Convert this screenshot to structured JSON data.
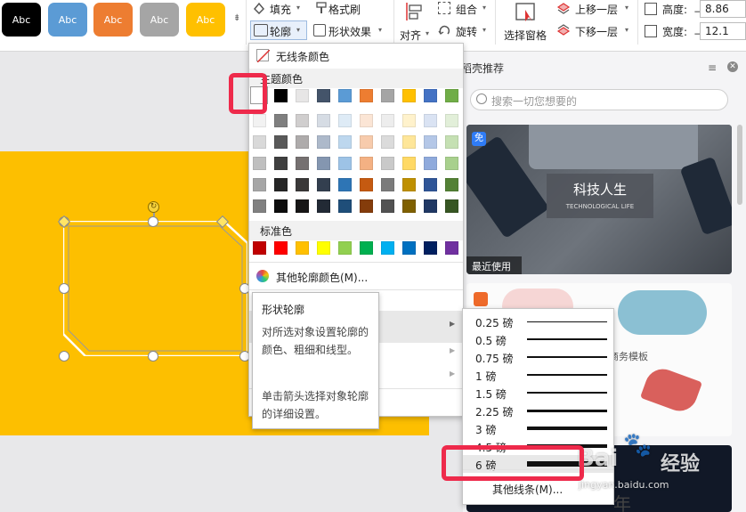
{
  "ribbon": {
    "styles": [
      "Abc",
      "Abc",
      "Abc",
      "Abc",
      "Abc"
    ],
    "fill_label": "填充",
    "format_brush_label": "格式刷",
    "outline_label": "轮廓",
    "shape_effect_label": "形状效果",
    "align_label": "对齐",
    "group_label": "组合",
    "rotate_label": "旋转",
    "selection_pane_label": "选择窗格",
    "bring_forward_label": "上移一层",
    "send_backward_label": "下移一层",
    "height_label": "高度:",
    "height_value": "8.86",
    "width_label": "宽度:",
    "width_value": "12.1"
  },
  "color_menu": {
    "no_line": "无线条颜色",
    "theme_colors_title": "主题颜色",
    "standard_colors_title": "标准色",
    "other_colors": "其他轮廓颜色(M)..."
  },
  "tooltip": {
    "title": "形状轮廓",
    "desc": "对所选对象设置轮廓的颜色、粗细和线型。",
    "hint": "单击箭头选择对象轮廓的详细设置。"
  },
  "weight_menu": {
    "items": [
      "0.25 磅",
      "0.5 磅",
      "0.75 磅",
      "1 磅",
      "1.5 磅",
      "2.25 磅",
      "3 磅",
      "4.5 磅",
      "6 磅"
    ],
    "other": "其他线条(M)..."
  },
  "right_panel": {
    "title": "稻壳推荐",
    "search_placeholder": "搜索一切您想要的",
    "card1_badge": "免",
    "card1_title": "科技人生",
    "card1_subtitle": "TECHNOLOGICAL LIFE",
    "card1_caption": "最近使用",
    "card2_text": "商务模板",
    "card3_text": "年"
  },
  "watermark": {
    "brand": "Bai",
    "brand2": "经验",
    "url": "jingyan.baidu.com"
  },
  "colors": {
    "accent_red": "#ee2a4b",
    "slide_yellow": "#fdbf00"
  }
}
